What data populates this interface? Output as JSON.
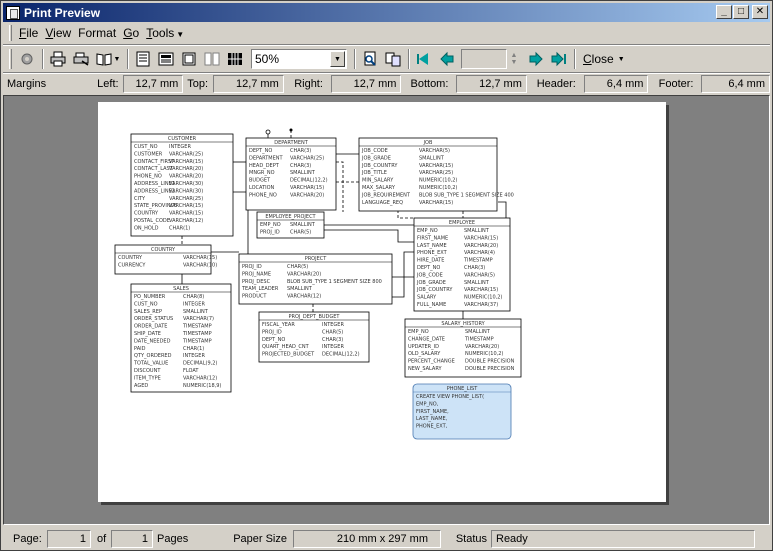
{
  "window": {
    "title": "Print Preview"
  },
  "menu": {
    "file": {
      "lead": "F",
      "rest": "ile"
    },
    "view": {
      "lead": "V",
      "rest": "iew"
    },
    "format": {
      "lead": "Format",
      "rest": ""
    },
    "go": {
      "lead": "G",
      "rest": "o"
    },
    "tools": {
      "lead": "T",
      "rest": "ools"
    }
  },
  "toolbar": {
    "zoom_value": "50%",
    "close_lead": "C",
    "close_rest": "lose"
  },
  "margins": {
    "label": "Margins",
    "left_label": "Left:",
    "left_value": "12,7 mm",
    "top_label": "Top:",
    "top_value": "12,7 mm",
    "right_label": "Right:",
    "right_value": "12,7 mm",
    "bottom_label": "Bottom:",
    "bottom_value": "12,7 mm",
    "header_label": "Header:",
    "header_value": "6,4 mm",
    "footer_label": "Footer:",
    "footer_value": "6,4 mm"
  },
  "status": {
    "page_label": "Page:",
    "page_value": "1",
    "of_label": "of",
    "of_value": "1",
    "pages_label": "Pages",
    "paper_label": "Paper Size",
    "paper_value": "210 mm x 297 mm",
    "status_label": "Status",
    "status_value": "Ready"
  },
  "diagram": {
    "customer": {
      "title": "CUSTOMER",
      "rows": [
        [
          "CUST_NO",
          "INTEGER"
        ],
        [
          "CUSTOMER",
          "VARCHAR(25)"
        ],
        [
          "CONTACT_FIRST",
          "VARCHAR(15)"
        ],
        [
          "CONTACT_LAST",
          "VARCHAR(20)"
        ],
        [
          "PHONE_NO",
          "VARCHAR(20)"
        ],
        [
          "ADDRESS_LINE1",
          "VARCHAR(30)"
        ],
        [
          "ADDRESS_LINE2",
          "VARCHAR(30)"
        ],
        [
          "CITY",
          "VARCHAR(25)"
        ],
        [
          "STATE_PROVINCE",
          "VARCHAR(15)"
        ],
        [
          "COUNTRY",
          "VARCHAR(15)"
        ],
        [
          "POSTAL_CODE",
          "VARCHAR(12)"
        ],
        [
          "ON_HOLD",
          "CHAR(1)"
        ]
      ]
    },
    "department": {
      "title": "DEPARTMENT",
      "rows": [
        [
          "DEPT_NO",
          "CHAR(3)"
        ],
        [
          "DEPARTMENT",
          "VARCHAR(25)"
        ],
        [
          "HEAD_DEPT",
          "CHAR(3)"
        ],
        [
          "MNGR_NO",
          "SMALLINT"
        ],
        [
          "BUDGET",
          "DECIMAL(12,2)"
        ],
        [
          "LOCATION",
          "VARCHAR(15)"
        ],
        [
          "PHONE_NO",
          "VARCHAR(20)"
        ]
      ]
    },
    "job": {
      "title": "JOB",
      "rows": [
        [
          "JOB_CODE",
          "VARCHAR(5)"
        ],
        [
          "JOB_GRADE",
          "SMALLINT"
        ],
        [
          "JOB_COUNTRY",
          "VARCHAR(15)"
        ],
        [
          "JOB_TITLE",
          "VARCHAR(25)"
        ],
        [
          "MIN_SALARY",
          "NUMERIC(10,2)"
        ],
        [
          "MAX_SALARY",
          "NUMERIC(10,2)"
        ],
        [
          "JOB_REQUIREMENT",
          "BLOB SUB_TYPE 1 SEGMENT SIZE 400"
        ],
        [
          "LANGUAGE_REQ",
          "VARCHAR(15)"
        ]
      ]
    },
    "employee_project": {
      "title": "EMPLOYEE_PROJECT",
      "rows": [
        [
          "EMP_NO",
          "SMALLINT"
        ],
        [
          "PROJ_ID",
          "CHAR(5)"
        ]
      ]
    },
    "employee": {
      "title": "EMPLOYEE",
      "rows": [
        [
          "EMP_NO",
          "SMALLINT"
        ],
        [
          "FIRST_NAME",
          "VARCHAR(15)"
        ],
        [
          "LAST_NAME",
          "VARCHAR(20)"
        ],
        [
          "PHONE_EXT",
          "VARCHAR(4)"
        ],
        [
          "HIRE_DATE",
          "TIMESTAMP"
        ],
        [
          "DEPT_NO",
          "CHAR(3)"
        ],
        [
          "JOB_CODE",
          "VARCHAR(5)"
        ],
        [
          "JOB_GRADE",
          "SMALLINT"
        ],
        [
          "JOB_COUNTRY",
          "VARCHAR(15)"
        ],
        [
          "SALARY",
          "NUMERIC(10,2)"
        ],
        [
          "FULL_NAME",
          "VARCHAR(37)"
        ]
      ]
    },
    "country": {
      "title": "COUNTRY",
      "rows": [
        [
          "COUNTRY",
          "VARCHAR(15)"
        ],
        [
          "CURRENCY",
          "VARCHAR(10)"
        ]
      ]
    },
    "project": {
      "title": "PROJECT",
      "rows": [
        [
          "PROJ_ID",
          "CHAR(5)"
        ],
        [
          "PROJ_NAME",
          "VARCHAR(20)"
        ],
        [
          "PROJ_DESC",
          "BLOB SUB_TYPE 1 SEGMENT SIZE 800"
        ],
        [
          "TEAM_LEADER",
          "SMALLINT"
        ],
        [
          "PRODUCT",
          "VARCHAR(12)"
        ]
      ]
    },
    "sales": {
      "title": "SALES",
      "rows": [
        [
          "PO_NUMBER",
          "CHAR(8)"
        ],
        [
          "CUST_NO",
          "INTEGER"
        ],
        [
          "SALES_REP",
          "SMALLINT"
        ],
        [
          "ORDER_STATUS",
          "VARCHAR(7)"
        ],
        [
          "ORDER_DATE",
          "TIMESTAMP"
        ],
        [
          "SHIP_DATE",
          "TIMESTAMP"
        ],
        [
          "DATE_NEEDED",
          "TIMESTAMP"
        ],
        [
          "PAID",
          "CHAR(1)"
        ],
        [
          "QTY_ORDERED",
          "INTEGER"
        ],
        [
          "TOTAL_VALUE",
          "DECIMAL(9,2)"
        ],
        [
          "DISCOUNT",
          "FLOAT"
        ],
        [
          "ITEM_TYPE",
          "VARCHAR(12)"
        ],
        [
          "AGED",
          "NUMERIC(18,9)"
        ]
      ]
    },
    "proj_dept_budget": {
      "title": "PROJ_DEPT_BUDGET",
      "rows": [
        [
          "FISCAL_YEAR",
          "INTEGER"
        ],
        [
          "PROJ_ID",
          "CHAR(5)"
        ],
        [
          "DEPT_NO",
          "CHAR(3)"
        ],
        [
          "QUART_HEAD_CNT",
          "INTEGER"
        ],
        [
          "PROJECTED_BUDGET",
          "DECIMAL(12,2)"
        ]
      ]
    },
    "salary_history": {
      "title": "SALARY_HISTORY",
      "rows": [
        [
          "EMP_NO",
          "SMALLINT"
        ],
        [
          "CHANGE_DATE",
          "TIMESTAMP"
        ],
        [
          "UPDATER_ID",
          "VARCHAR(20)"
        ],
        [
          "OLD_SALARY",
          "NUMERIC(10,2)"
        ],
        [
          "PERCENT_CHANGE",
          "DOUBLE PRECISION"
        ],
        [
          "NEW_SALARY",
          "DOUBLE PRECISION"
        ]
      ]
    },
    "phone_list": {
      "title": "PHONE_LIST",
      "rows": [
        [
          "CREATE VIEW PHONE_LIST(",
          ""
        ],
        [
          "  EMP_NO,",
          ""
        ],
        [
          "  FIRST_NAME,",
          ""
        ],
        [
          "  LAST_NAME,",
          ""
        ],
        [
          "  PHONE_EXT,",
          ""
        ]
      ]
    }
  },
  "colors": {
    "view_fill": "#cde3f7",
    "view_border": "#4a78b0"
  }
}
